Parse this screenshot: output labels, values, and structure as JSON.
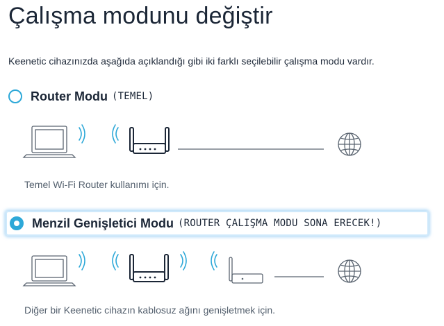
{
  "page": {
    "title": "Çalışma modunu değiştir",
    "description": "Keenetic cihazınızda aşağıda açıklandığı gibi iki farklı seçilebilir çalışma modu vardır."
  },
  "modes": [
    {
      "name": "Router Modu",
      "note": "(TEMEL)",
      "caption": "Temel Wi-Fi Router kullanımı için.",
      "selected": false
    },
    {
      "name": "Menzil Genişletici Modu",
      "note": "(ROUTER ÇALIŞMA MODU SONA ERECEK!)",
      "caption": "Diğer bir Keenetic cihazın kablosuz ağını genişletmek için.",
      "selected": true
    }
  ],
  "icons": {
    "laptop": "laptop-icon",
    "wifi": "wifi-waves-icon",
    "router": "router-icon",
    "globe": "globe-icon"
  },
  "colors": {
    "accent": "#2da8d8",
    "text": "#1b2636",
    "muted": "#54606e",
    "focus_glow": "#cfe9fb"
  }
}
